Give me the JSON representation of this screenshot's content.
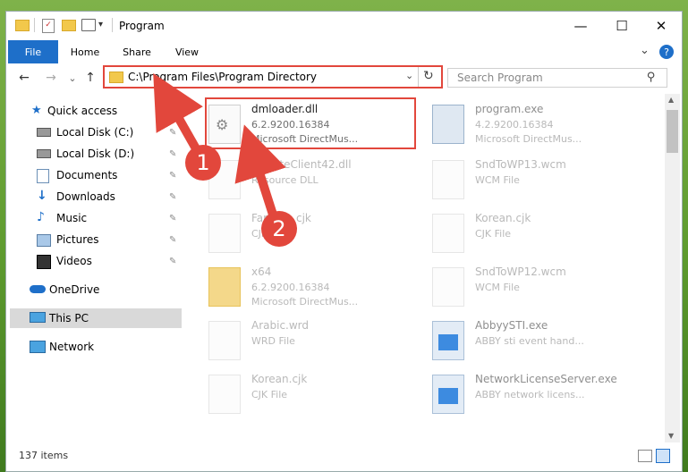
{
  "window": {
    "title": "Program",
    "controls": {
      "minimize": "—",
      "maximize": "☐",
      "close": "✕"
    }
  },
  "ribbon": {
    "tabs": [
      "File",
      "Home",
      "Share",
      "View"
    ],
    "help": "?",
    "chevron": "⌄"
  },
  "nav": {
    "back": "←",
    "forward": "→",
    "recent": "⌄",
    "up": "↑",
    "address": "C:\\Program Files\\Program Directory",
    "refresh": "↻",
    "search_placeholder": "Search Program"
  },
  "sidebar": {
    "items": [
      {
        "label": "Quick access",
        "icon": "star-icon",
        "pinned": false
      },
      {
        "label": "Local Disk (C:)",
        "icon": "drive-icon",
        "pinned": true
      },
      {
        "label": "Local Disk (D:)",
        "icon": "drive-icon",
        "pinned": true
      },
      {
        "label": "Documents",
        "icon": "documents-icon",
        "pinned": true
      },
      {
        "label": "Downloads",
        "icon": "download-icon",
        "pinned": true
      },
      {
        "label": "Music",
        "icon": "music-icon",
        "pinned": true
      },
      {
        "label": "Pictures",
        "icon": "pictures-icon",
        "pinned": true
      },
      {
        "label": "Videos",
        "icon": "videos-icon",
        "pinned": true
      },
      {
        "label": "OneDrive",
        "icon": "cloud-icon",
        "pinned": false
      },
      {
        "label": "This PC",
        "icon": "computer-icon",
        "pinned": false,
        "selected": true
      },
      {
        "label": "Network",
        "icon": "network-icon",
        "pinned": false
      }
    ]
  },
  "files": {
    "left": [
      {
        "name": "dmloader.dll",
        "line1": "6.2.9200.16384",
        "line2": "Microsoft DirectMus...",
        "highlighted": true
      },
      {
        "name": "UpdateClient42.dll",
        "line1": "Resource DLL",
        "line2": ""
      },
      {
        "name": "Faroese.cjk",
        "line1": "CJK File",
        "line2": ""
      },
      {
        "name": "x64",
        "line1": "6.2.9200.16384",
        "line2": "Microsoft DirectMus..."
      },
      {
        "name": "Arabic.wrd",
        "line1": "WRD File",
        "line2": ""
      },
      {
        "name": "Korean.cjk",
        "line1": "CJK File",
        "line2": ""
      }
    ],
    "right": [
      {
        "name": "program.exe",
        "line1": "4.2.9200.16384",
        "line2": "Microsoft DirectMus..."
      },
      {
        "name": "SndToWP13.wcm",
        "line1": "WCM File",
        "line2": ""
      },
      {
        "name": "Korean.cjk",
        "line1": "CJK File",
        "line2": ""
      },
      {
        "name": "SndToWP12.wcm",
        "line1": "WCM File",
        "line2": ""
      },
      {
        "name": "AbbyySTI.exe",
        "line1": "ABBY sti event hand...",
        "line2": ""
      },
      {
        "name": "NetworkLicenseServer.exe",
        "line1": "ABBY network licens...",
        "line2": ""
      }
    ]
  },
  "status": {
    "item_count": "137 items"
  },
  "annotations": {
    "step1": "1",
    "step2": "2"
  },
  "colors": {
    "accent": "#1e6fc9",
    "highlight": "#e2473c"
  }
}
